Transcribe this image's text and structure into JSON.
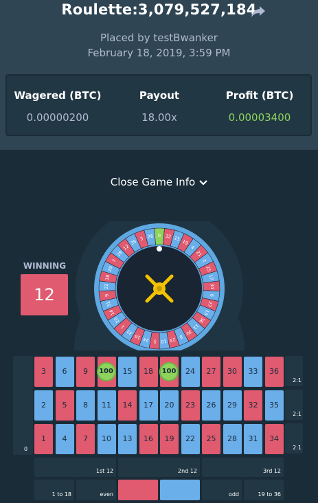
{
  "header": {
    "title": "Roulette:3,079,527,184",
    "placed_by": "Placed by testBwanker",
    "date": "February 18, 2019, 3:59 PM"
  },
  "stats": {
    "wagered_label": "Wagered (BTC)",
    "wagered_value": "0.00000200",
    "payout_label": "Payout",
    "payout_value": "18.00x",
    "profit_label": "Profit (BTC)",
    "profit_value": "0.00003400"
  },
  "close_info_label": "Close Game Info",
  "winning": {
    "label": "WINNING",
    "number": "12"
  },
  "wheel": {
    "sequence": [
      "0",
      "32",
      "15",
      "19",
      "4",
      "21",
      "2",
      "25",
      "17",
      "34",
      "6",
      "27",
      "13",
      "36",
      "11",
      "30",
      "8",
      "23",
      "10",
      "5",
      "24",
      "16",
      "33",
      "1",
      "20",
      "14",
      "31",
      "9",
      "22",
      "18",
      "29",
      "7",
      "28",
      "12",
      "35",
      "3",
      "26"
    ],
    "red_numbers": [
      1,
      3,
      5,
      7,
      9,
      12,
      14,
      16,
      18,
      19,
      21,
      23,
      25,
      27,
      30,
      32,
      34,
      36
    ]
  },
  "board": {
    "zero": "0",
    "rows": [
      [
        "3",
        "6",
        "9",
        "12",
        "15",
        "18",
        "21",
        "24",
        "27",
        "30",
        "33",
        "36"
      ],
      [
        "2",
        "5",
        "8",
        "11",
        "14",
        "17",
        "20",
        "23",
        "26",
        "29",
        "32",
        "35"
      ],
      [
        "1",
        "4",
        "7",
        "10",
        "13",
        "16",
        "19",
        "22",
        "25",
        "28",
        "31",
        "34"
      ]
    ],
    "columns": [
      "2:1",
      "2:1",
      "2:1"
    ],
    "dozens": [
      "1st 12",
      "2nd 12",
      "3rd 12"
    ],
    "outside": {
      "low": "1 to 18",
      "even": "even",
      "odd": "odd",
      "high": "19 to 36"
    },
    "chips": [
      {
        "label": "100",
        "on_number": "12"
      },
      {
        "label": "100",
        "on_number": "21"
      }
    ]
  },
  "colors": {
    "red": "#e05a70",
    "blue": "#6aaeea",
    "green": "#8ed35c",
    "bg": "#1a2c38",
    "panel": "#2f4553"
  }
}
